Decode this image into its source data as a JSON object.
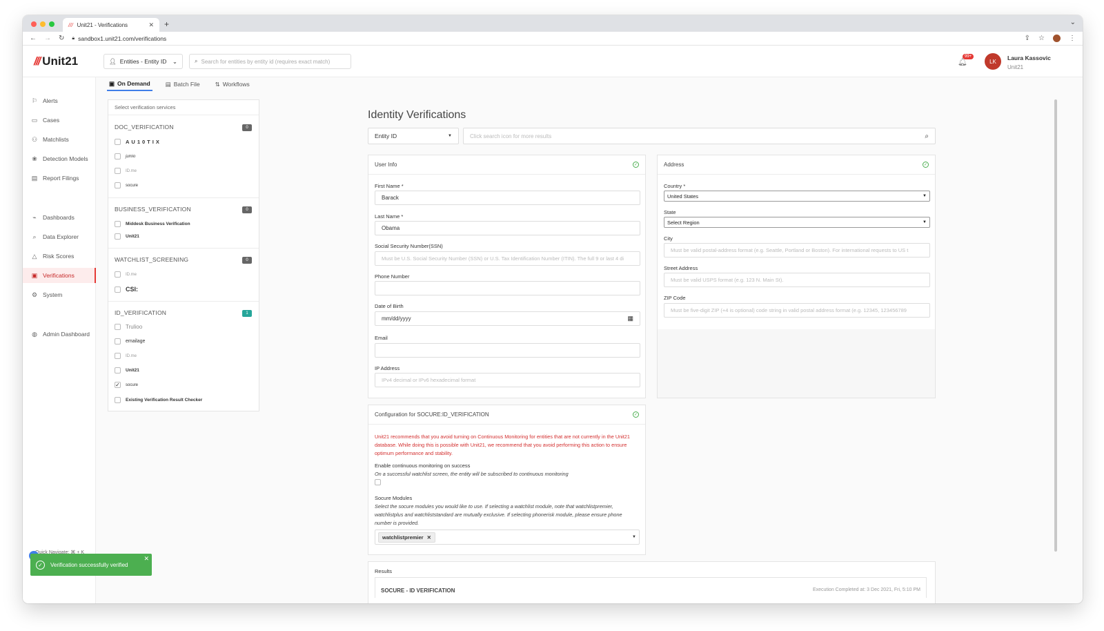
{
  "browser": {
    "tab_title": "Unit21 - Verifications",
    "url": "sandbox1.unit21.com/verifications"
  },
  "header": {
    "logo": "Unit21",
    "entity_selector": "Entities - Entity ID",
    "search_placeholder": "Search for entities by entity id (requires exact match)",
    "notification_count": "99+",
    "user_initials": "LK",
    "user_name": "Laura Kassovic",
    "user_org": "Unit21"
  },
  "sidebar": {
    "items": [
      {
        "label": "Alerts",
        "icon": "flag-icon"
      },
      {
        "label": "Cases",
        "icon": "briefcase-icon"
      },
      {
        "label": "Matchlists",
        "icon": "user-plus-icon"
      },
      {
        "label": "Detection Models",
        "icon": "brain-icon"
      },
      {
        "label": "Report Filings",
        "icon": "file-icon"
      },
      {
        "label": "Dashboards",
        "icon": "chart-icon"
      },
      {
        "label": "Data Explorer",
        "icon": "search-doc-icon"
      },
      {
        "label": "Risk Scores",
        "icon": "warning-icon"
      },
      {
        "label": "Verifications",
        "icon": "id-card-icon",
        "active": true
      },
      {
        "label": "System",
        "icon": "gear-icon"
      },
      {
        "label": "Admin Dashboard",
        "icon": "globe-icon"
      }
    ],
    "quick_navigate": "Quick Navigate: ⌘ + K"
  },
  "toast": {
    "message": "Verification successfully verified"
  },
  "subtabs": [
    {
      "label": "On Demand",
      "active": true
    },
    {
      "label": "Batch File"
    },
    {
      "label": "Workflows"
    }
  ],
  "services": {
    "header": "Select verification services",
    "groups": [
      {
        "title": "DOC_VERIFICATION",
        "count": "0",
        "vendors": [
          "AU10TIX",
          "jumio",
          "ID.me",
          "socure"
        ]
      },
      {
        "title": "BUSINESS_VERIFICATION",
        "count": "0",
        "vendors": [
          "Middesk Business Verification",
          "Unit21"
        ]
      },
      {
        "title": "WATCHLIST_SCREENING",
        "count": "0",
        "vendors": [
          "ID.me",
          "CSI:"
        ]
      },
      {
        "title": "ID_VERIFICATION",
        "count": "1",
        "vendors": [
          "Trulioo",
          "emailage",
          "ID.me",
          "Unit21",
          "socure",
          "Existing Verification Result Checker"
        ],
        "checked_index": 4
      }
    ]
  },
  "main": {
    "title": "Identity Verifications",
    "id_type": "Entity ID",
    "search_placeholder": "Click search icon for more results"
  },
  "user_info": {
    "title": "User Info",
    "first_name_label": "First Name *",
    "first_name": "Barack",
    "last_name_label": "Last Name *",
    "last_name": "Obama",
    "ssn_label": "Social Security Number(SSN)",
    "ssn_placeholder": "Must be U.S. Social Security Number (SSN) or U.S. Tax Identification Number (ITIN). The full 9 or last 4 di",
    "phone_label": "Phone Number",
    "dob_label": "Date of Birth",
    "dob_value": "mm/dd/yyyy",
    "email_label": "Email",
    "ip_label": "IP Address",
    "ip_placeholder": "IPv4 decimal or IPv6 hexadecimal format"
  },
  "address": {
    "title": "Address",
    "country_label": "Country *",
    "country": "United States",
    "state_label": "State",
    "state": "Select Region",
    "city_label": "City",
    "city_placeholder": "Must be valid postal-address format (e.g. Seattle, Portland or Boston). For international requests to US t",
    "street_label": "Street Address",
    "street_placeholder": "Must be valid USPS format (e.g. 123 N. Main St).",
    "zip_label": "ZIP Code",
    "zip_placeholder": "Must be five-digit ZIP (+4 is optional) code string in valid postal address format (e.g. 12345, 123456789"
  },
  "config": {
    "title": "Configuration for SOCURE:ID_VERIFICATION",
    "warning": "Unit21 recommends that you avoid turning on Continuous Monitoring for entities that are not currently in the Unit21 database. While doing this is possible with Unit21, we recommend that you avoid performing this action to ensure optimum performance and stability.",
    "monitor_label": "Enable continuous monitoring on success",
    "monitor_desc": "On a successful watchlist screen, the entity will be subscribed to continuous monitoring",
    "modules_label": "Socure Modules",
    "modules_desc": "Select the socure modules you would like to use. If selecting a watchlist module, note that watchlistpremier, watchlistplus and watchliststandard are mutually exclusive. If selecting phonerisk module, please ensure phone number is provided.",
    "selected_module": "watchlistpremier"
  },
  "results": {
    "title": "Results",
    "vendor": "SOCURE - ID VERIFICATION",
    "executed": "Execution Completed at: 3 Dec 2021, Fri, 5:10 PM"
  },
  "colors": {
    "brand": "#e53935",
    "success": "#4caf50",
    "link": "#3f7ee8",
    "warning_text": "#d32f2f"
  }
}
